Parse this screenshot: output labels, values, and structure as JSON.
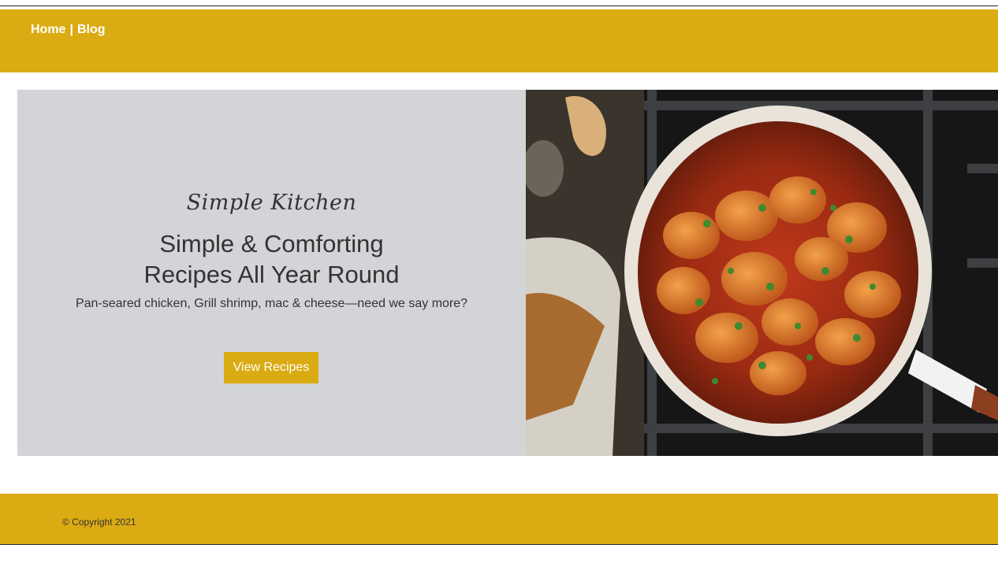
{
  "nav": {
    "links": [
      {
        "label": "Home"
      },
      {
        "label": "Blog"
      }
    ],
    "separator": "|"
  },
  "hero": {
    "brand": "Simple Kitchen",
    "headline_line1": "Simple & Comforting",
    "headline_line2": "Recipes All Year Round",
    "subline": "Pan-seared chicken, Grill shrimp, mac & cheese—need we say more?",
    "cta_label": "View Recipes",
    "image_icon": "shrimp-skillet-photo"
  },
  "footer": {
    "copyright": "© Copyright 2021"
  },
  "colors": {
    "accent": "#dbab13",
    "panel": "#d3d4d7",
    "text": "#333333"
  }
}
